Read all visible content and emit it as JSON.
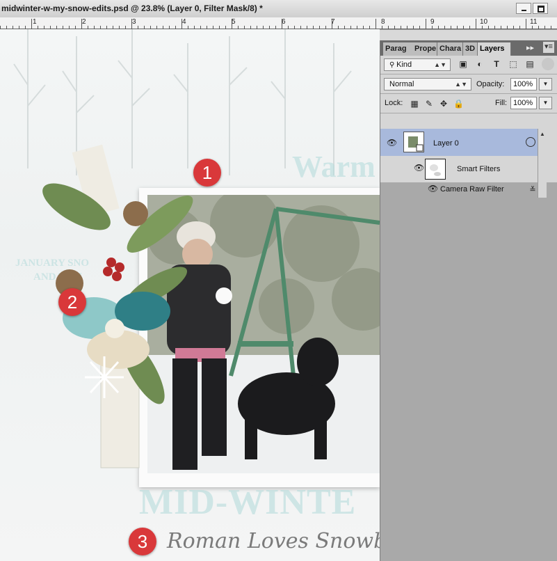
{
  "window": {
    "title": "midwinter-w-my-snow-edits.psd @ 23.8% (Layer 0, Filter Mask/8) *"
  },
  "ruler": {
    "numbers": [
      "1",
      "2",
      "3",
      "4",
      "5",
      "6",
      "7",
      "8",
      "9",
      "10",
      "11"
    ]
  },
  "canvas": {
    "caption": "Roman Loves Snowballs!",
    "wash_texts": [
      "Warm",
      "JANUARY SNO",
      "AND TEM",
      "MID-WINTE"
    ],
    "badges": [
      "1",
      "2",
      "3"
    ]
  },
  "panel": {
    "tabs": [
      "Parag",
      "Prope",
      "Chara",
      "3D",
      "Layers"
    ],
    "active_tab": "Layers",
    "filter_kind": "Kind",
    "blend_mode": "Normal",
    "opacity_label": "Opacity:",
    "opacity_value": "100%",
    "lock_label": "Lock:",
    "fill_label": "Fill:",
    "fill_value": "100%",
    "layers": {
      "layer_name": "Layer 0",
      "smart_filters": "Smart Filters",
      "camera_raw": "Camera Raw Filter"
    }
  },
  "colors": {
    "badge": "#d9383a",
    "selected_layer": "#a8b9dc",
    "panel_bg": "#d6d6d6"
  }
}
